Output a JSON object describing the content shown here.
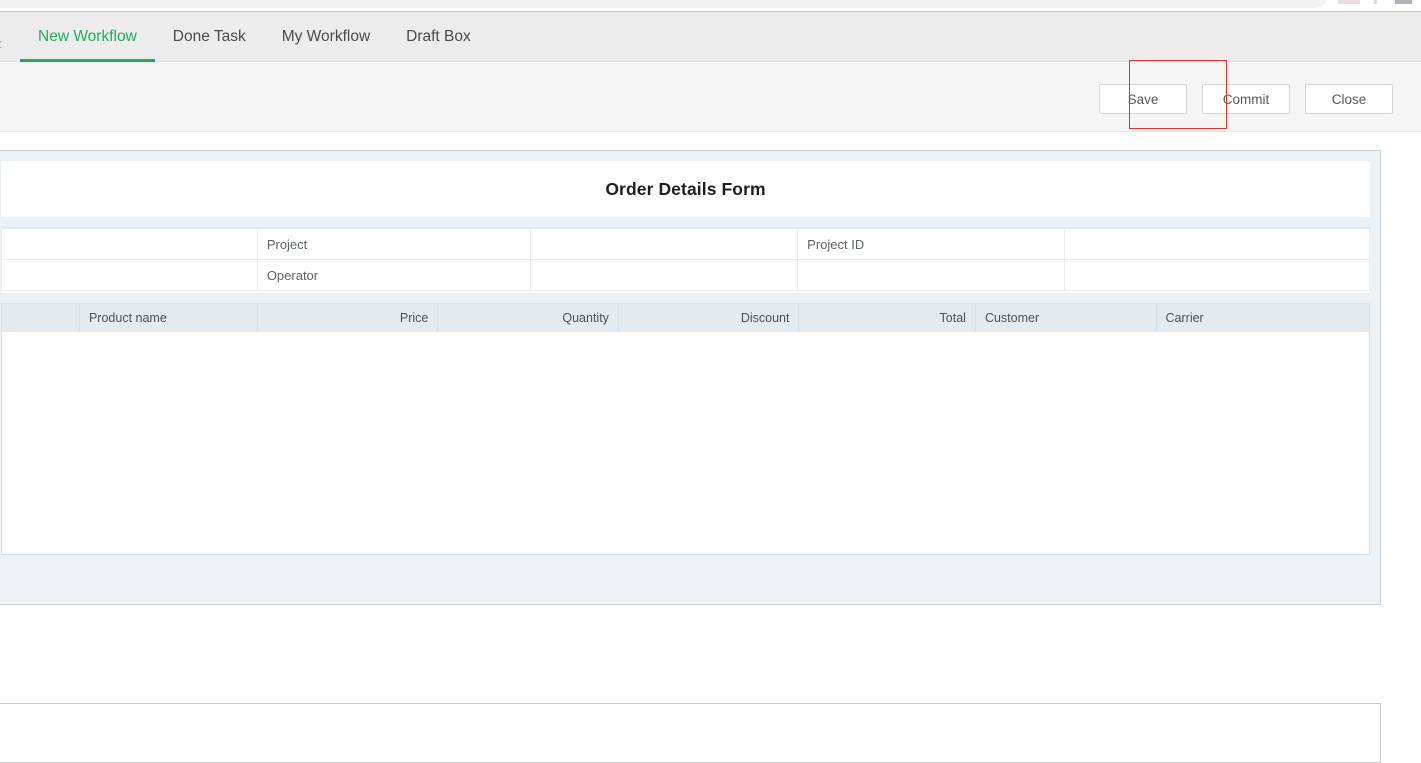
{
  "window": {
    "background_color": "#ffffff",
    "accent_color": "#22ac5c",
    "highlight_color": "#e03232"
  },
  "tabbar": {
    "left_fragment": ":",
    "tabs": [
      {
        "label": "New Workflow",
        "active": true
      },
      {
        "label": "Done Task",
        "active": false
      },
      {
        "label": "My Workflow",
        "active": false
      },
      {
        "label": "Draft Box",
        "active": false
      }
    ]
  },
  "actionbar": {
    "buttons": [
      {
        "label": "Save",
        "name": "save-button",
        "highlighted": true
      },
      {
        "label": "Commit",
        "name": "commit-button",
        "highlighted": false
      },
      {
        "label": "Close",
        "name": "close-button",
        "highlighted": false
      }
    ]
  },
  "form": {
    "title": "Order Details Form",
    "rows": [
      {
        "cells": [
          {
            "type": "value",
            "text": ""
          },
          {
            "type": "label",
            "text": "Project"
          },
          {
            "type": "value",
            "text": ""
          },
          {
            "type": "label",
            "text": "Project ID"
          },
          {
            "type": "value",
            "text": ""
          }
        ]
      },
      {
        "cells": [
          {
            "type": "value",
            "text": ""
          },
          {
            "type": "label",
            "text": "Operator"
          },
          {
            "type": "value",
            "text": ""
          },
          {
            "type": "label",
            "text": ""
          },
          {
            "type": "value",
            "text": ""
          }
        ]
      }
    ]
  },
  "grid": {
    "columns": [
      {
        "label": "",
        "align": "left"
      },
      {
        "label": "Product name",
        "align": "left"
      },
      {
        "label": "Price",
        "align": "right"
      },
      {
        "label": "Quantity",
        "align": "right"
      },
      {
        "label": "Discount",
        "align": "right"
      },
      {
        "label": "Total",
        "align": "right"
      },
      {
        "label": "Customer",
        "align": "left"
      },
      {
        "label": "Carrier",
        "align": "left"
      }
    ],
    "rows": []
  }
}
